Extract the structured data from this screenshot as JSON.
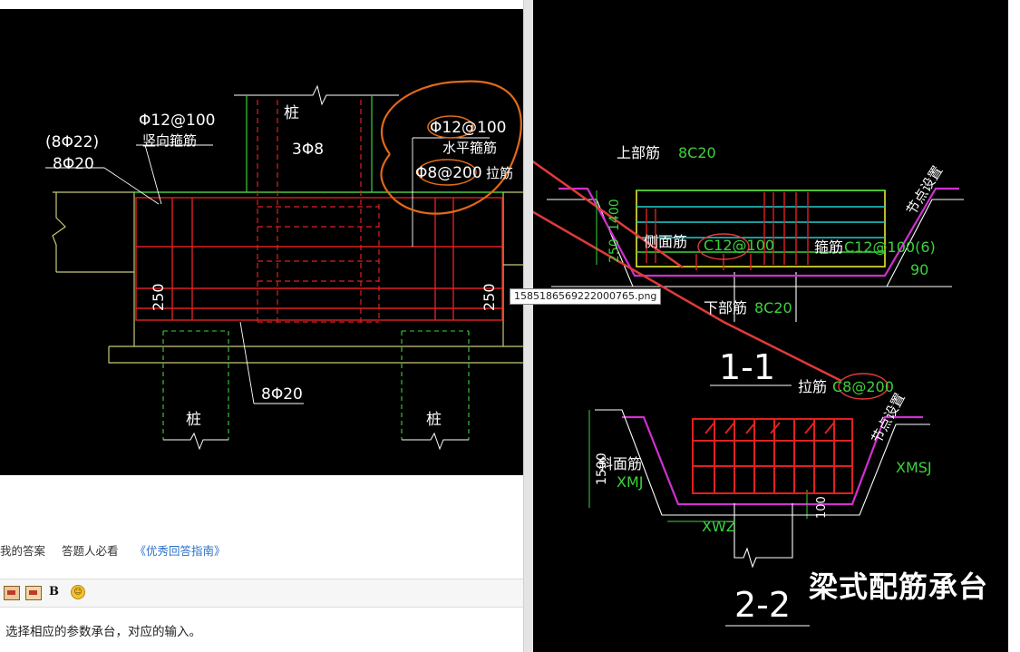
{
  "left_drawing": {
    "label_pile_top": "桩",
    "label_3phi8": "3Φ8",
    "label_vert_spacing": "Φ12@100",
    "label_vert_stirrup": "竖向箍筋",
    "label_8phi22": "(8Φ22)",
    "label_8phi20_top": "8Φ20",
    "label_horiz_spacing": "Φ12@100",
    "label_horiz_stirrup": "水平箍筋",
    "label_tie": "Φ8@200",
    "label_tie_name": "拉筋",
    "label_250_left": "250",
    "label_250_right": "250",
    "label_8phi20_bottom": "8Φ20",
    "label_pile_left": "桩",
    "label_pile_right": "桩"
  },
  "tabs": {
    "my_answer": "我的答案",
    "must_read": "答题人必看",
    "guide": "《优秀回答指南》"
  },
  "toolbar": {
    "bold_label": "B"
  },
  "editor": {
    "text": "选择相应的参数承台，对应的输入。"
  },
  "tooltip": {
    "filename": "1585186569222000765.png"
  },
  "right_drawing": {
    "top_bar_label": "上部筋",
    "top_bar_value": "8C20",
    "node_setting_1": "节点设置",
    "dim_1400": "1400",
    "dim_250": "250",
    "side_bar_label": "侧面筋",
    "side_bar_value": "C12@100",
    "stirrup_label": "箍筋",
    "stirrup_value": "C12@100(6)",
    "angle_90": "90",
    "bottom_bar_label": "下部筋",
    "bottom_bar_value": "8C20",
    "section_1": "1-1",
    "tie_label": "拉筋",
    "tie_value": "C8@200",
    "node_setting_2": "节点设置",
    "dim_1500": "1500",
    "slope_label": "斜面筋",
    "xmj": "XMJ",
    "xmsj": "XMSJ",
    "dim_100": "100",
    "xwz": "XWZ",
    "section_2": "2-2",
    "title": "梁式配筋承台"
  },
  "colors": {
    "cad_background": "#000000",
    "rebar_red": "#e02020",
    "annotation_orange": "#e06a1a",
    "arrow_red": "#e23a3a",
    "dim_green": "#3cd23c",
    "outline_white": "#ffffff",
    "magenta": "#d030d0",
    "guide_link_blue": "#2a6fc9"
  }
}
